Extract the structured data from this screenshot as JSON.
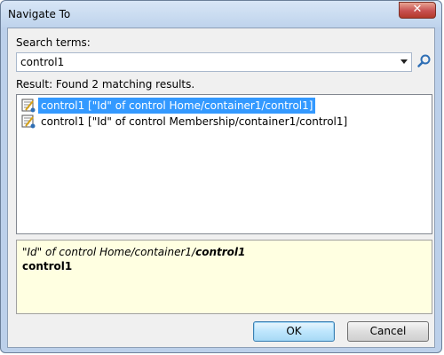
{
  "window": {
    "title": "Navigate To",
    "close_symbol": "✕"
  },
  "search": {
    "label": "Search terms:",
    "value": "control1",
    "search_icon": "magnifier-icon"
  },
  "results": {
    "summary": "Result: Found 2 matching results.",
    "items": [
      {
        "text": "control1 [\"Id\" of control Home/container1/control1]",
        "selected": true,
        "icon": "property-icon"
      },
      {
        "text": "control1 [\"Id\" of control Membership/container1/control1]",
        "selected": false,
        "icon": "property-icon"
      }
    ]
  },
  "details": {
    "line1_prefix": "\"Id\" of control Home/container1/",
    "line1_bold": "control1",
    "line2": "control1"
  },
  "buttons": {
    "ok": "OK",
    "cancel": "Cancel"
  },
  "colors": {
    "selection": "#3399ff",
    "details_bg": "#ffffe1"
  }
}
